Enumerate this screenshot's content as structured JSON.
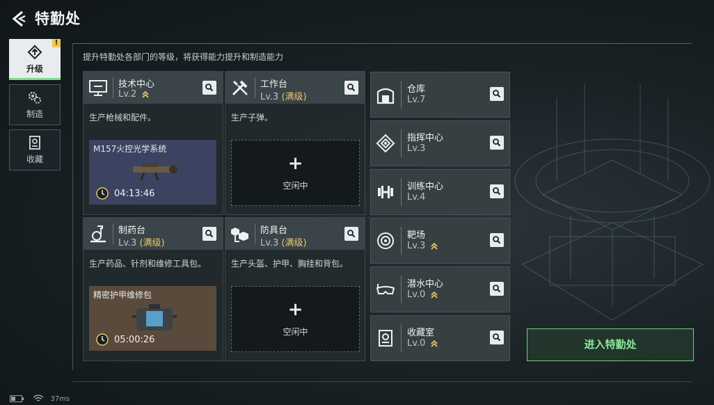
{
  "header": {
    "title": "特勤处"
  },
  "subtitle": "提升特勤处各部门的等级，将获得能力提升和制造能力",
  "tabs": [
    {
      "label": "升级",
      "icon": "upgrade-icon",
      "active": true,
      "badge": "!"
    },
    {
      "label": "制造",
      "icon": "gears-icon",
      "active": false
    },
    {
      "label": "收藏",
      "icon": "collection-icon",
      "active": false
    }
  ],
  "cards": [
    {
      "name": "技术中心",
      "level": "Lv.2",
      "max": "",
      "icon": "tech-center-icon",
      "upgradable": true,
      "desc": "生产枪械和配件。",
      "product": "M157火控光学系统",
      "timer": "04:13:46",
      "idle": false
    },
    {
      "name": "工作台",
      "level": "Lv.3",
      "max": "(满级)",
      "icon": "workbench-icon",
      "upgradable": false,
      "desc": "生产子弹。",
      "idle": true
    },
    {
      "name": "制药台",
      "level": "Lv.3",
      "max": "(满级)",
      "icon": "pharmacy-icon",
      "upgradable": false,
      "desc": "生产药品、针剂和维修工具包。",
      "product": "精密护甲维修包",
      "timer": "05:00:26",
      "idle": false
    },
    {
      "name": "防具台",
      "level": "Lv.3",
      "max": "(满级)",
      "icon": "armor-bench-icon",
      "upgradable": false,
      "desc": "生产头盔、护甲、胸挂和背包。",
      "idle": true
    }
  ],
  "idle_label": "空闲中",
  "idle_plus": "+",
  "list": [
    {
      "name": "仓库",
      "level": "Lv.7",
      "icon": "warehouse-icon",
      "upgradable": false
    },
    {
      "name": "指挥中心",
      "level": "Lv.3",
      "icon": "command-center-icon",
      "upgradable": false
    },
    {
      "name": "训练中心",
      "level": "Lv.4",
      "icon": "training-center-icon",
      "upgradable": false
    },
    {
      "name": "靶场",
      "level": "Lv.3",
      "icon": "shooting-range-icon",
      "upgradable": true
    },
    {
      "name": "潜水中心",
      "level": "Lv.0",
      "icon": "diving-center-icon",
      "upgradable": true
    },
    {
      "name": "收藏室",
      "level": "Lv.0",
      "icon": "collection-room-icon",
      "upgradable": true
    }
  ],
  "enter_button": "进入特勤处",
  "status": {
    "ping": "37ms"
  },
  "colors": {
    "accent_green": "#7fe08d",
    "max_gold": "#e9c46a"
  }
}
